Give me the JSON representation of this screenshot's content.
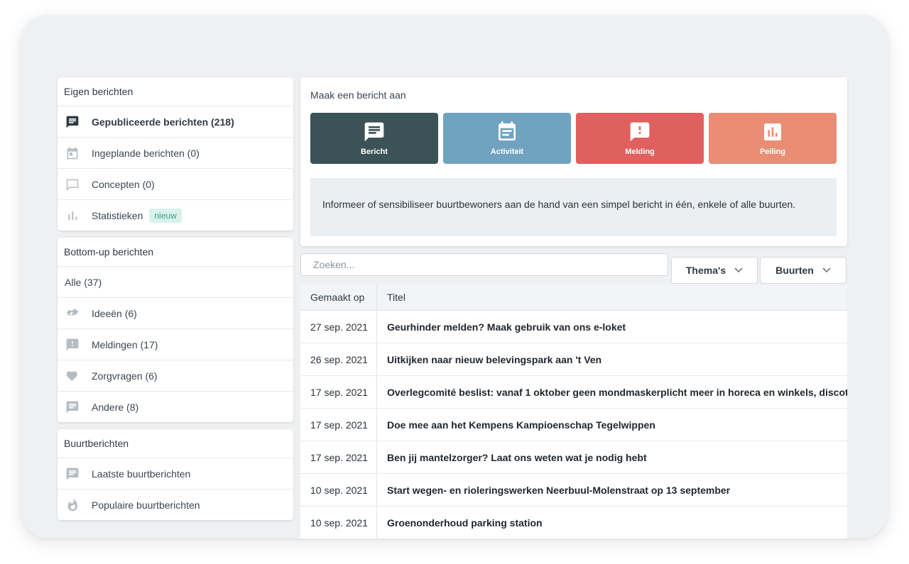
{
  "sidebar": {
    "own": {
      "heading": "Eigen berichten",
      "items": [
        {
          "label": "Gepubliceerde berichten (218)",
          "icon": "message-icon",
          "active": true
        },
        {
          "label": "Ingeplande berichten (0)",
          "icon": "calendar-icon"
        },
        {
          "label": "Concepten (0)",
          "icon": "draft-icon"
        },
        {
          "label": "Statistieken",
          "icon": "stats-icon",
          "badge": "nieuw"
        }
      ]
    },
    "bottomup": {
      "heading": "Bottom-up berichten",
      "all": "Alle (37)",
      "items": [
        {
          "label": "Ideeën (6)",
          "icon": "handshake-icon"
        },
        {
          "label": "Meldingen (17)",
          "icon": "alert-icon"
        },
        {
          "label": "Zorgvragen (6)",
          "icon": "heart-icon"
        },
        {
          "label": "Andere (8)",
          "icon": "message-icon"
        }
      ]
    },
    "neighbourhood": {
      "heading": "Buurtberichten",
      "items": [
        {
          "label": "Laatste buurtberichten",
          "icon": "message-icon"
        },
        {
          "label": "Populaire buurtberichten",
          "icon": "fire-icon"
        }
      ]
    }
  },
  "compose": {
    "title": "Maak een bericht aan",
    "types": [
      {
        "label": "Bericht",
        "icon": "message-icon",
        "color": "#3b5257"
      },
      {
        "label": "Activiteit",
        "icon": "calendar-icon",
        "color": "#6fa3bf"
      },
      {
        "label": "Melding",
        "icon": "alert-icon",
        "color": "#e0605f"
      },
      {
        "label": "Peiling",
        "icon": "poll-icon",
        "color": "#e98d74"
      }
    ],
    "description": "Informeer of sensibiliseer buurtbewoners aan de hand van een simpel bericht in één, enkele of alle buurten."
  },
  "search": {
    "placeholder": "Zoeken..."
  },
  "filters": {
    "themes": "Thema's",
    "neighbourhoods": "Buurten"
  },
  "table": {
    "headers": {
      "date": "Gemaakt op",
      "title": "Titel"
    },
    "rows": [
      {
        "date": "27 sep. 2021",
        "title": "Geurhinder melden? Maak gebruik van ons e-loket"
      },
      {
        "date": "26 sep. 2021",
        "title": "Uitkijken naar nieuw belevingspark aan 't Ven"
      },
      {
        "date": "17 sep. 2021",
        "title": "Overlegcomité beslist: vanaf 1 oktober geen mondmaskerplicht meer in horeca en winkels, discotheken bi"
      },
      {
        "date": "17 sep. 2021",
        "title": "Doe mee aan het Kempens Kampioenschap Tegelwippen"
      },
      {
        "date": "17 sep. 2021",
        "title": "Ben jij mantelzorger? Laat ons weten wat je nodig hebt"
      },
      {
        "date": "10 sep. 2021",
        "title": "Start wegen- en rioleringswerken Neerbuul-Molenstraat op 13 september"
      },
      {
        "date": "10 sep. 2021",
        "title": "Groenonderhoud parking station"
      }
    ]
  }
}
